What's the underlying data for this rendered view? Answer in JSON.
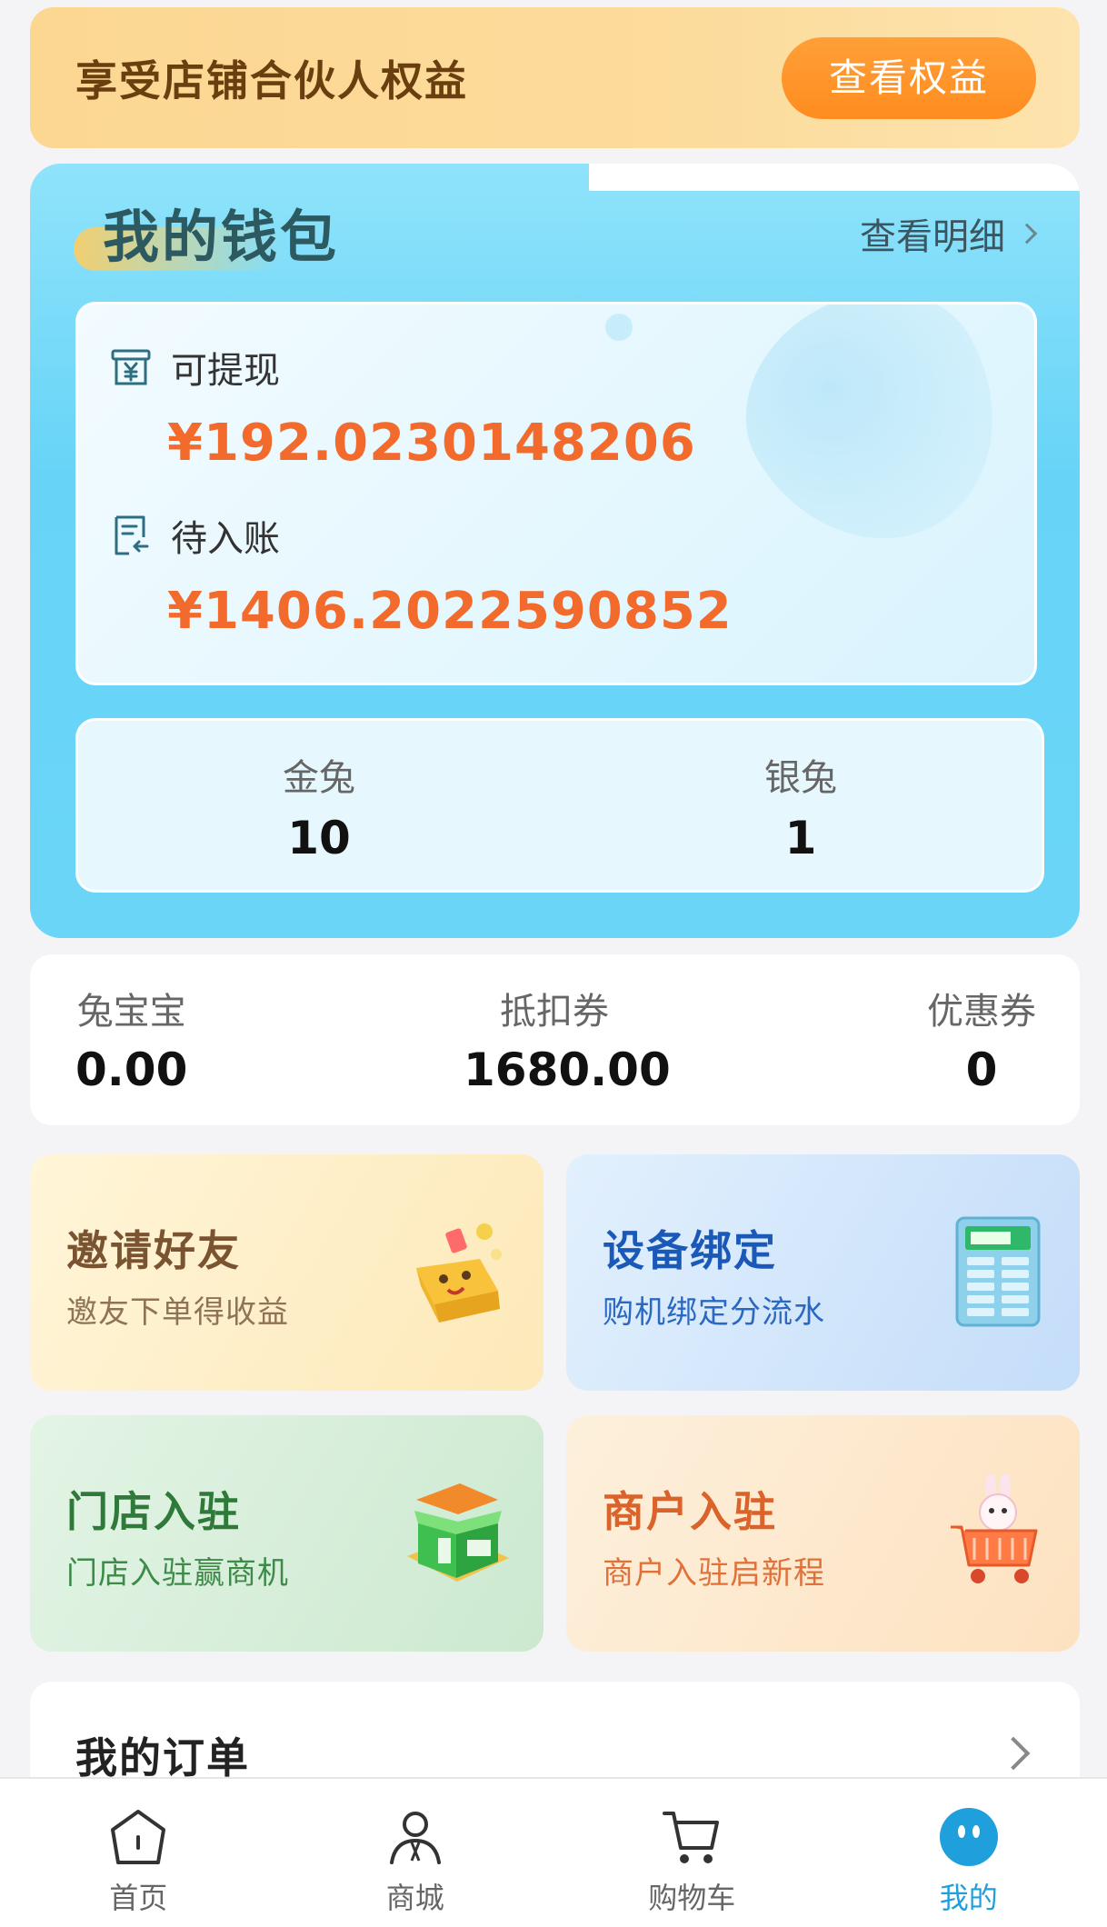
{
  "banner": {
    "title": "享受店铺合伙人权益",
    "button": "查看权益"
  },
  "wallet": {
    "title": "我的钱包",
    "detail_link": "查看明细",
    "withdrawable": {
      "label": "可提现",
      "amount": "¥192.0230148206",
      "icon": "yen-box-icon"
    },
    "pending": {
      "label": "待入账",
      "amount": "¥1406.2022590852",
      "icon": "document-return-icon"
    },
    "gold_rabbit": {
      "label": "金兔",
      "value": "10"
    },
    "silver_rabbit": {
      "label": "银兔",
      "value": "1"
    }
  },
  "stats": [
    {
      "label": "兔宝宝",
      "value": "0.00"
    },
    {
      "label": "抵扣券",
      "value": "1680.00"
    },
    {
      "label": "优惠券",
      "value": "0"
    }
  ],
  "tiles": {
    "invite": {
      "title": "邀请好友",
      "subtitle": "邀友下单得收益",
      "icon": "gift-box-icon"
    },
    "device": {
      "title": "设备绑定",
      "subtitle": "购机绑定分流水",
      "icon": "device-terminal-icon"
    },
    "store": {
      "title": "门店入驻",
      "subtitle": "门店入驻赢商机",
      "icon": "market-store-icon"
    },
    "merchant": {
      "title": "商户入驻",
      "subtitle": "商户入驻启新程",
      "icon": "rabbit-cart-icon"
    }
  },
  "orders": {
    "title": "我的订单"
  },
  "tabbar": [
    {
      "label": "首页",
      "icon": "home-icon"
    },
    {
      "label": "商城",
      "icon": "person-icon"
    },
    {
      "label": "购物车",
      "icon": "cart-icon"
    },
    {
      "label": "我的",
      "icon": "profile-face-icon",
      "active": true
    }
  ],
  "colors": {
    "accent": "#1fa0dc",
    "amount": "#f26b2d",
    "banner_button": "#ff8c1f"
  }
}
